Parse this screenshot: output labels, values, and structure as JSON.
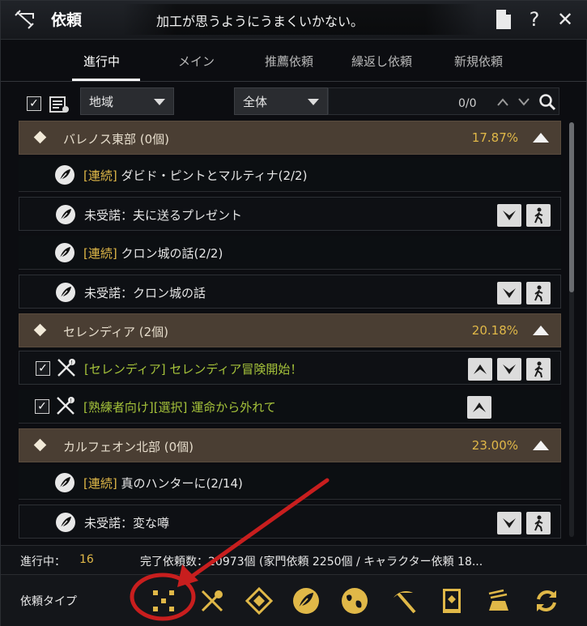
{
  "window": {
    "title": "依頼",
    "message": "加工が思うようにうまくいかない。",
    "buttons": {
      "help": "?",
      "close": "✕"
    }
  },
  "tabs": [
    {
      "label": "進行中",
      "active": true
    },
    {
      "label": "メイン",
      "active": false
    },
    {
      "label": "推薦依頼",
      "active": false
    },
    {
      "label": "繰返し依頼",
      "active": false
    },
    {
      "label": "新規依頼",
      "active": false
    }
  ],
  "filters": {
    "region_select": "地域",
    "scope_select": "全体",
    "search_count": "0/0"
  },
  "regions": [
    {
      "name": "バレノス東部 (0個)",
      "percent": "17.87%",
      "quests": [
        {
          "tag": "[連続]",
          "name": " ダビド・ピントとマルティナ(2/2)",
          "buttons": []
        },
        {
          "tag": "",
          "name": "未受諾：夫に送るプレゼント",
          "buttons": [
            "down",
            "walk"
          ]
        },
        {
          "tag": "[連続]",
          "name": " クロン城の話(2/2)",
          "buttons": []
        },
        {
          "tag": "",
          "name": "未受諾：クロン城の話",
          "buttons": [
            "down",
            "walk"
          ]
        }
      ]
    },
    {
      "name": "セレンディア (2個)",
      "percent": "20.18%",
      "quests": [
        {
          "tag": "[セレンディア]",
          "name": " セレンディア冒険開始！",
          "buttons": [
            "up",
            "down",
            "walk"
          ],
          "checked": true
        },
        {
          "tag": "[熟練者向け][選択]",
          "name": " 運命から外れて",
          "buttons": [
            "up"
          ],
          "checked": true
        }
      ]
    },
    {
      "name": "カルフェオン北部 (0個)",
      "percent": "23.00%",
      "quests": [
        {
          "tag": "[連続]",
          "name": " 真のハンターに(2/14)",
          "buttons": []
        },
        {
          "tag": "",
          "name": "未受諾：変な噂",
          "buttons": [
            "down",
            "walk"
          ]
        }
      ]
    }
  ],
  "footer": {
    "in_progress_label": "進行中：",
    "in_progress_value": "16",
    "completed_text": "完了依頼数：20973個 (家門依頼 2250個 / キャラクター依頼 18..."
  },
  "quest_types": {
    "label": "依頼タイプ",
    "icons": [
      "all-types-icon",
      "scroll-icon",
      "diamond-road-icon",
      "feather-icon",
      "world-icon",
      "pickaxe-icon",
      "book-icon",
      "crafting-icon",
      "repeat-icon"
    ]
  },
  "colors": {
    "accent_gold": "#e0b848",
    "quest_green": "#a5c23a",
    "region_bar": "#4a3e33",
    "annotation_red": "#c81e1e"
  }
}
